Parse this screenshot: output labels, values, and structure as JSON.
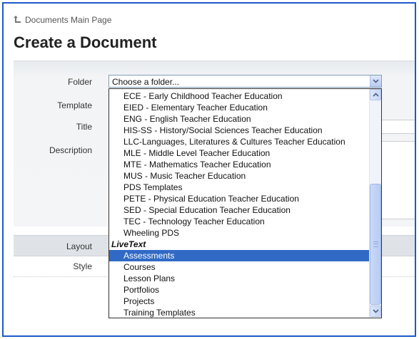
{
  "breadcrumb": {
    "label": "Documents Main Page"
  },
  "page": {
    "title": "Create a Document"
  },
  "form": {
    "labels": {
      "folder": "Folder",
      "template": "Template",
      "title": "Title",
      "description": "Description",
      "layout": "Layout",
      "style": "Style"
    }
  },
  "folder_select": {
    "value": "Choose a folder...",
    "options": [
      "ECE - Early Childhood Teacher Education",
      "EIED - Elementary Teacher Education",
      "ENG - English Teacher Education",
      "HIS-SS - History/Social Sciences Teacher Education",
      "LLC-Languages, Literatures & Cultures Teacher Education",
      "MLE - Middle Level Teacher Education",
      "MTE - Mathematics Teacher Education",
      "MUS - Music Teacher Education",
      "PDS Templates",
      "PETE - Physical Education Teacher Education",
      "SED - Special Education Teacher Education",
      "TEC - Technology Teacher Education",
      "Wheeling PDS"
    ],
    "group_label": "LiveText",
    "group_options": [
      "Assessments",
      "Courses",
      "Lesson Plans",
      "Portfolios",
      "Projects",
      "Training Templates"
    ],
    "selected": "Assessments"
  },
  "colors": {
    "frame_border": "#1c5ac8",
    "selection": "#316ac5"
  },
  "icons": {
    "breadcrumb": "back-arrow-icon",
    "select": "chevron-down-icon",
    "scroll_up": "chevron-up-icon",
    "scroll_down": "chevron-down-icon"
  }
}
